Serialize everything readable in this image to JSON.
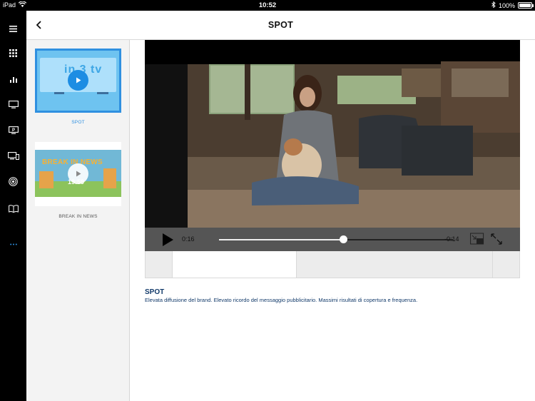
{
  "status_bar": {
    "device": "iPad",
    "time": "10:52",
    "battery": "100%",
    "battery_level": 1.0
  },
  "rail": {
    "icons": [
      "menu-icon",
      "grid-icon",
      "bar-chart-icon",
      "tv-icon",
      "parking-sign-icon",
      "devices-icon",
      "radio-icon",
      "book-icon",
      "more-icon"
    ]
  },
  "header": {
    "title": "SPOT"
  },
  "list": {
    "items": [
      {
        "caption": "SPOT",
        "selected": true,
        "thumb_text": "in 3 tv"
      },
      {
        "caption": "BREAK IN NEWS",
        "selected": false,
        "thumb_text": "BREAK IN NEWS",
        "thumb_clock": "19:59"
      }
    ]
  },
  "player": {
    "elapsed": "0:16",
    "remaining": "-0:14",
    "progress": 0.53
  },
  "description": {
    "title": "SPOT",
    "text": "Elevata diffusione del brand. Elevato ricordo del messaggio pubblicitario. Massimi risultati di copertura e frequenza."
  },
  "colors": {
    "accent": "#2f90e0",
    "caption_selected": "#2f90e0",
    "caption_default": "#555555",
    "description": "#123a6a"
  }
}
